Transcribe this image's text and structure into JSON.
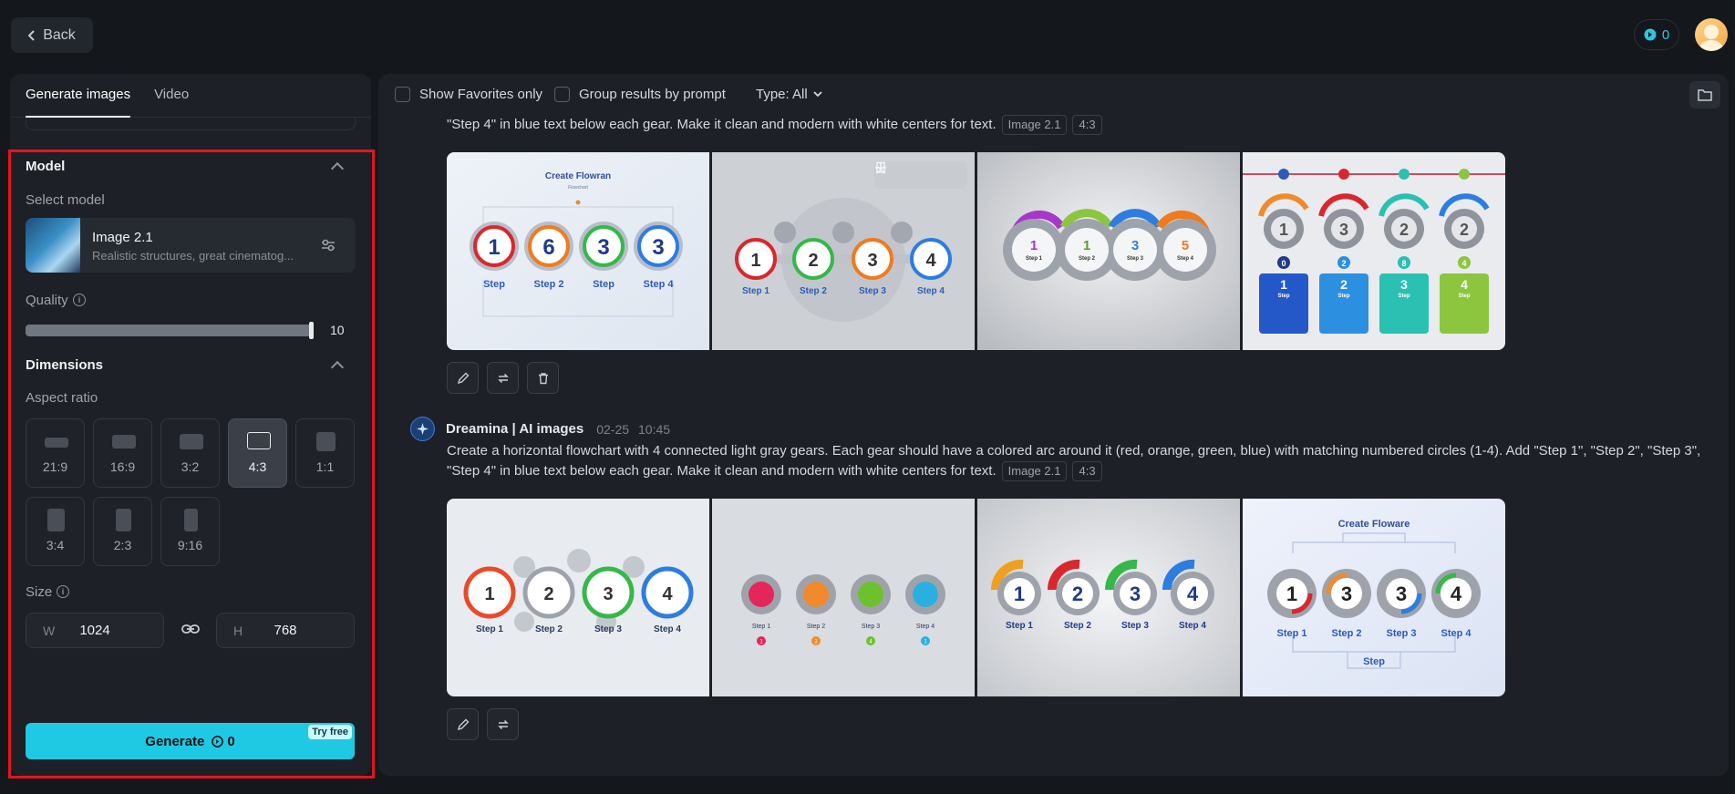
{
  "topbar": {
    "back_label": "Back",
    "credits": "0"
  },
  "left_panel": {
    "tabs": [
      {
        "label": "Generate images"
      },
      {
        "label": "Video"
      }
    ],
    "model_section": {
      "title": "Model",
      "select_label": "Select model",
      "model_name": "Image 2.1",
      "model_desc": "Realistic structures, great cinematog...",
      "quality_label": "Quality",
      "quality_value": "10",
      "quality_fraction": 1.0
    },
    "dimensions_section": {
      "title": "Dimensions",
      "aspect_label": "Aspect ratio",
      "ratios": [
        {
          "label": "21:9",
          "selected": false
        },
        {
          "label": "16:9",
          "selected": false
        },
        {
          "label": "3:2",
          "selected": false
        },
        {
          "label": "4:3",
          "selected": true
        },
        {
          "label": "1:1",
          "selected": false
        },
        {
          "label": "3:4",
          "selected": false
        },
        {
          "label": "2:3",
          "selected": false
        },
        {
          "label": "9:16",
          "selected": false
        }
      ],
      "size_label": "Size",
      "width_prefix": "W",
      "width": "1024",
      "height_prefix": "H",
      "height": "768"
    },
    "generate": {
      "label": "Generate",
      "cost": "0",
      "badge": "Try free"
    }
  },
  "main": {
    "filters": {
      "favorites": "Show Favorites only",
      "group": "Group results by prompt",
      "type": "Type: All"
    },
    "group1": {
      "prompt_tail": "\"Step 4\" in blue text below each gear. Make it clean and modern with white centers for text.",
      "tag_model": "Image 2.1",
      "tag_ratio": "4:3",
      "images": [
        {
          "title": "Create Flowran",
          "subtitle": "Flowchart",
          "nums": [
            "1",
            "6",
            "3",
            "3"
          ],
          "steps": [
            "Step",
            "Step 2",
            "Step",
            "Step 4"
          ]
        },
        {
          "nums": [
            "1",
            "2",
            "3",
            "4"
          ],
          "steps": [
            "Step 1",
            "Step 2",
            "Step 3",
            "Step 4"
          ]
        },
        {
          "nums": [
            "1",
            "1",
            "3",
            "5"
          ],
          "steps": [
            "Step 1",
            "Step 2",
            "Step 3",
            "Step 4"
          ]
        },
        {
          "nums": [
            "1",
            "3",
            "2",
            "2"
          ],
          "badges": [
            "0",
            "2",
            "8",
            "4"
          ],
          "cards": [
            "1",
            "2",
            "3",
            "4"
          ],
          "card_caption": "Step"
        }
      ]
    },
    "group2": {
      "author": "Dreamina | AI images",
      "date": "02-25",
      "time": "10:45",
      "prompt": "Create a horizontal flowchart with 4 connected light gray gears. Each gear should have a colored arc around it (red, orange, green, blue) with matching numbered circles (1-4). Add \"Step 1\", \"Step 2\", \"Step 3\",",
      "prompt_line2": "\"Step 4\" in blue text below each gear. Make it clean and modern with white centers for text.",
      "tag_model": "Image 2.1",
      "tag_ratio": "4:3",
      "images": [
        {
          "nums": [
            "1",
            "2",
            "3",
            "4"
          ],
          "steps": [
            "Step 1",
            "Step 2",
            "Step 3",
            "Step 4"
          ]
        },
        {
          "badges": [
            "1",
            "3",
            "4",
            "1"
          ],
          "steps": [
            "Step 1",
            "Step 2",
            "Step 3",
            "Step 4"
          ]
        },
        {
          "nums": [
            "1",
            "2",
            "3",
            "4"
          ],
          "steps": [
            "Step 1",
            "Step 2",
            "Step 3",
            "Step 4"
          ]
        },
        {
          "title": "Create Floware",
          "nums": [
            "1",
            "3",
            "3",
            "4"
          ],
          "steps": [
            "Step 1",
            "Step 2",
            "Step 3",
            "Step 4"
          ],
          "footer": "Step"
        }
      ]
    }
  },
  "colors": {
    "accent": "#20c9e3",
    "highlight": "#e1161c",
    "panel": "#1d2027",
    "bg": "#14171c"
  }
}
